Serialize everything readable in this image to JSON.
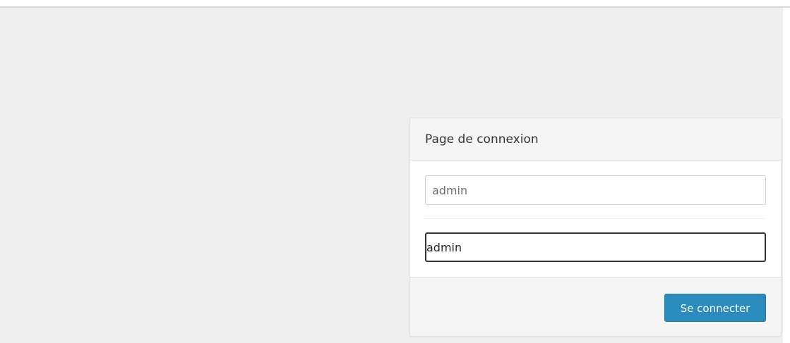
{
  "login": {
    "title": "Page de connexion",
    "username_value": "admin",
    "password_value": "admin",
    "submit_label": "Se connecter"
  },
  "colors": {
    "page_background": "#efefef",
    "panel_background": "#ffffff",
    "panel_header_background": "#f5f5f5",
    "button_background": "#2a8bbf",
    "button_text": "#ffffff"
  }
}
